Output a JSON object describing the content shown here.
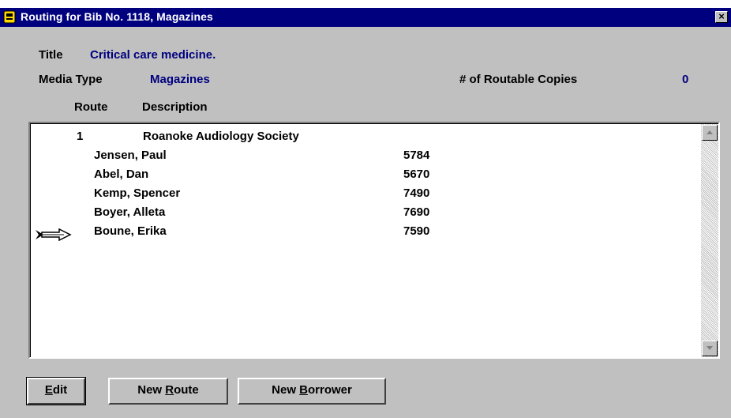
{
  "window": {
    "title": "Routing for Bib No. 1118, Magazines",
    "close_label": "×"
  },
  "header": {
    "title_label": "Title",
    "title_value": "Critical care medicine.",
    "media_type_label": "Media Type",
    "media_type_value": "Magazines",
    "routable_copies_label": "# of Routable Copies",
    "routable_copies_value": "0"
  },
  "columns": {
    "route": "Route",
    "description": "Description"
  },
  "routes": [
    {
      "number": "1",
      "description": "Roanoke Audiology Society",
      "borrowers": [
        {
          "name": "Jensen, Paul",
          "id": "5784"
        },
        {
          "name": "Abel, Dan",
          "id": "5670"
        },
        {
          "name": "Kemp, Spencer",
          "id": "7490"
        },
        {
          "name": "Boyer, Alleta",
          "id": "7690"
        },
        {
          "name": "Boune, Erika",
          "id": "7590",
          "selected": true
        }
      ]
    }
  ],
  "buttons": {
    "edit_prefix": "",
    "edit_mnemonic": "E",
    "edit_suffix": "dit",
    "new_route_prefix": "New ",
    "new_route_mnemonic": "R",
    "new_route_suffix": "oute",
    "new_borrower_prefix": "New ",
    "new_borrower_mnemonic": "B",
    "new_borrower_suffix": "orrower"
  },
  "colors": {
    "titlebar": "#00007f",
    "value_text": "#00007f",
    "face": "#c0c0c0"
  },
  "icons": {
    "window": "app-icon",
    "selection": "double-arrow-icon"
  }
}
